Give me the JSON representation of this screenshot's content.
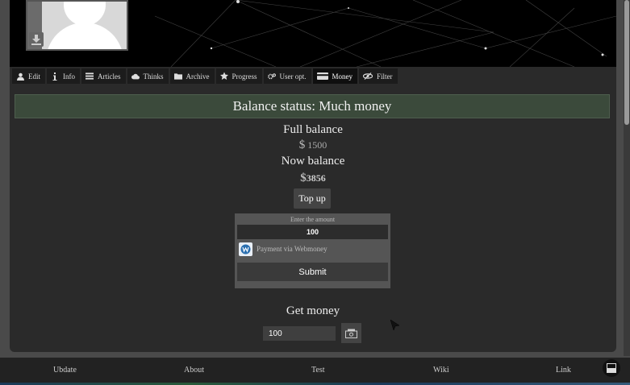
{
  "nav": {
    "tabs": [
      {
        "label": "Edit",
        "icon": "user-icon"
      },
      {
        "label": "Info",
        "icon": "info-icon"
      },
      {
        "label": "Articles",
        "icon": "list-icon"
      },
      {
        "label": "Thinks",
        "icon": "cloud-icon"
      },
      {
        "label": "Archive",
        "icon": "folder-icon"
      },
      {
        "label": "Progress",
        "icon": "star-icon"
      },
      {
        "label": "User opt.",
        "icon": "gears-icon"
      },
      {
        "label": "Money",
        "icon": "card-icon",
        "active": true
      },
      {
        "label": "Filter",
        "icon": "eye-slash-icon"
      }
    ]
  },
  "balance": {
    "status": "Balance status: Much money",
    "full_label": "Full balance",
    "full_currency": "$",
    "full_amount": "1500",
    "now_label": "Now balance",
    "now_currency": "$",
    "now_amount": "3856",
    "topup_label": "Top up"
  },
  "payment": {
    "enter_label": "Enter the amount",
    "amount_value": "100",
    "method_label": "Payment via Webmoney",
    "submit_label": "Submit"
  },
  "get_money": {
    "title": "Get money",
    "amount_value": "100"
  },
  "footer": {
    "links": [
      "Ubdate",
      "About",
      "Test",
      "Wiki",
      "Link"
    ]
  },
  "colors": {
    "status_bg": "#3b4a3b",
    "page_bg": "#2a2a2a",
    "outer_bg": "#4a4a4a"
  }
}
